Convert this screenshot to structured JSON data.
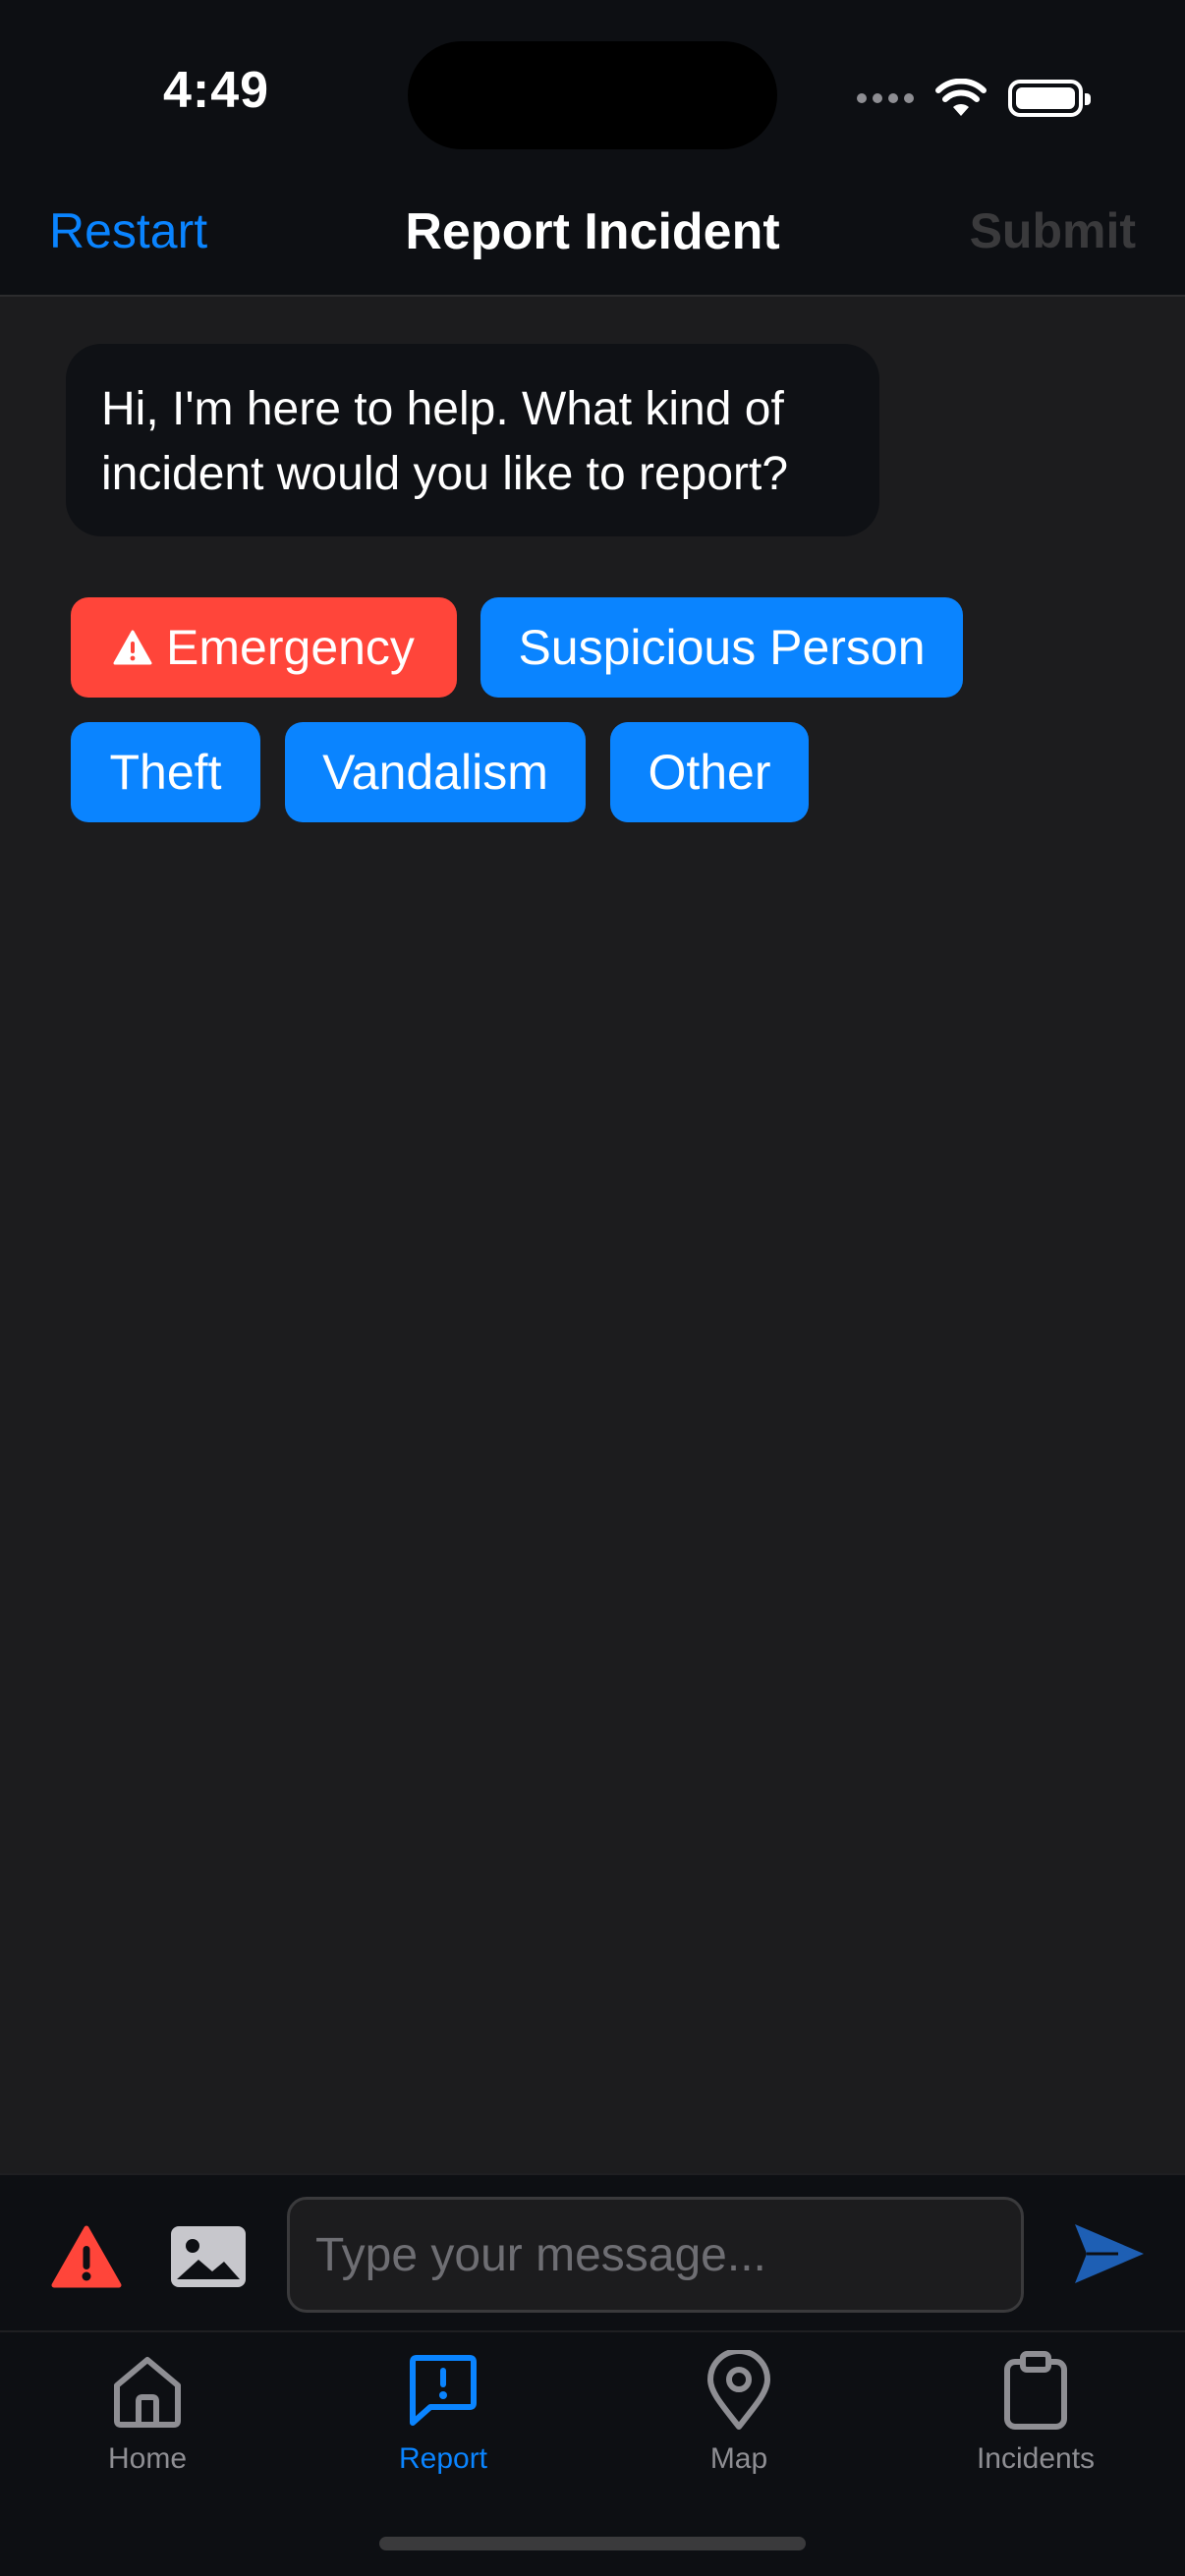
{
  "status_bar": {
    "time": "4:49"
  },
  "header": {
    "restart_label": "Restart",
    "title": "Report Incident",
    "submit_label": "Submit"
  },
  "chat": {
    "bot_message": "Hi, I'm here to help. What kind of incident would you like to report?"
  },
  "quick_replies": {
    "emergency": "Emergency",
    "suspicious_person": "Suspicious Person",
    "theft": "Theft",
    "vandalism": "Vandalism",
    "other": "Other"
  },
  "composer": {
    "placeholder": "Type your message...",
    "value": ""
  },
  "tabs": [
    {
      "label": "Home",
      "icon": "home-icon",
      "active": false
    },
    {
      "label": "Report",
      "icon": "report-icon",
      "active": true
    },
    {
      "label": "Map",
      "icon": "map-pin-icon",
      "active": false
    },
    {
      "label": "Incidents",
      "icon": "clipboard-icon",
      "active": false
    }
  ],
  "colors": {
    "accent": "#0a84ff",
    "emergency": "#ff453a",
    "background": "#1c1c1e",
    "bar_background": "#0d0f13",
    "disabled": "#3a3a3c",
    "inactive": "#8e8e93"
  }
}
